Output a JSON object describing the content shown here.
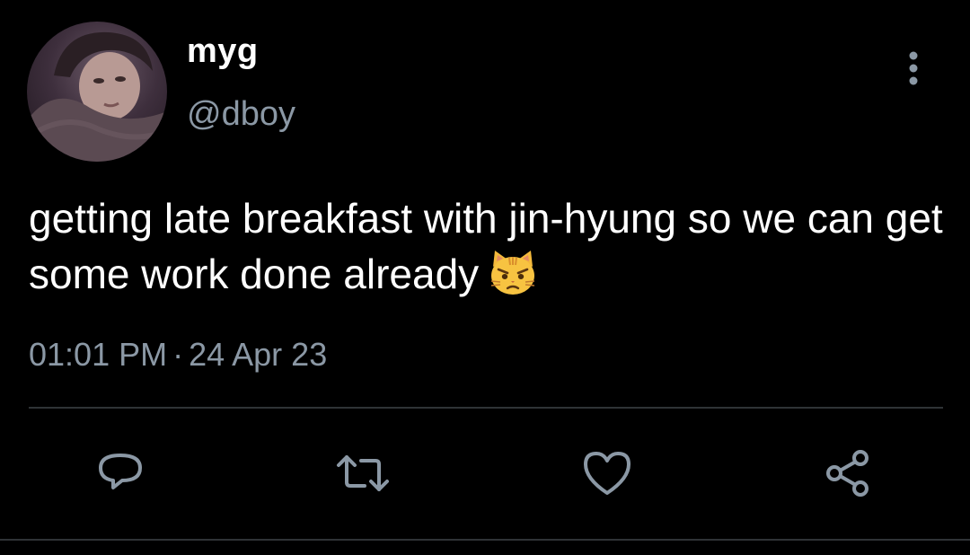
{
  "user": {
    "display_name": "myg",
    "handle": "@dboy",
    "avatar_icon": "profile-photo"
  },
  "tweet": {
    "text": "getting late breakfast with jin-hyung so we can get some work done already",
    "emoji": "pouting-cat-face"
  },
  "meta": {
    "time": "01:01 PM",
    "separator": "·",
    "date": "24 Apr 23"
  },
  "actions": {
    "reply_icon": "reply-icon",
    "retweet_icon": "retweet-icon",
    "like_icon": "heart-icon",
    "share_icon": "share-icon",
    "more_icon": "more-vertical-icon"
  },
  "colors": {
    "background": "#000000",
    "primary_text": "#ffffff",
    "secondary_text": "#8b98a5",
    "divider": "#2f3336",
    "icon": "#8b98a5"
  }
}
